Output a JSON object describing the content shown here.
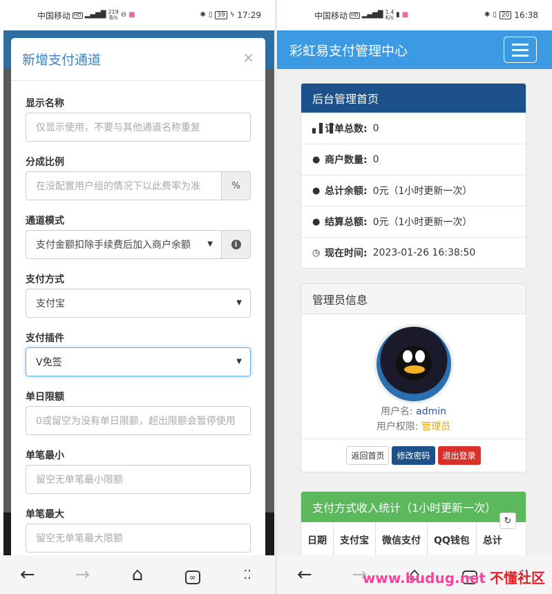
{
  "left_phone": {
    "status": {
      "carrier": "中国移动",
      "speed": "219",
      "speed_unit": "B/s",
      "battery": "39",
      "time": "17:29"
    },
    "modal": {
      "title": "新增支付通道",
      "close": "×",
      "fields": [
        {
          "label": "显示名称",
          "placeholder": "仅显示使用，不要与其他通道名称重复"
        },
        {
          "label": "分成比例",
          "placeholder": "在没配置用户组的情况下以此费率为准",
          "addon": "%"
        },
        {
          "label": "通道模式",
          "value": "支付金额扣除手续费后加入商户余额"
        },
        {
          "label": "支付方式",
          "value": "支付宝"
        },
        {
          "label": "支付插件",
          "value": "V免签"
        },
        {
          "label": "单日限额",
          "placeholder": "0或留空为没有单日限额，超出限额会暂停使用"
        },
        {
          "label": "单笔最小",
          "placeholder": "留空无单笔最小限额"
        },
        {
          "label": "单笔最大",
          "placeholder": "留空无单笔最大限额"
        }
      ]
    }
  },
  "right_phone": {
    "status": {
      "carrier": "中国移动",
      "speed": "1.4",
      "speed_unit": "K/s",
      "battery": "20",
      "time": "16:38"
    },
    "brand": "彩虹易支付管理中心",
    "dashboard": {
      "title": "后台管理首页",
      "rows": [
        {
          "label": "订单总数:",
          "value": "0"
        },
        {
          "label": "商户数量:",
          "value": "0"
        },
        {
          "label": "总计余额:",
          "value": "0元（1小时更新一次）"
        },
        {
          "label": "结算总额:",
          "value": "0元（1小时更新一次）"
        },
        {
          "label": "现在时间:",
          "value": "2023-01-26 16:38:50"
        }
      ]
    },
    "admin": {
      "title": "管理员信息",
      "username_label": "用户名:",
      "username": "admin",
      "role_label": "用户权限:",
      "role": "管理员",
      "btn_home": "返回首页",
      "btn_password": "修改密码",
      "btn_logout": "退出登录"
    },
    "stats": {
      "title": "支付方式收入统计（1小时更新一次）",
      "columns": [
        "日期",
        "支付宝",
        "微信支付",
        "QQ钱包",
        "总计"
      ]
    }
  },
  "watermark": {
    "part1": "www.budug.net",
    "part2": "不懂社区"
  }
}
